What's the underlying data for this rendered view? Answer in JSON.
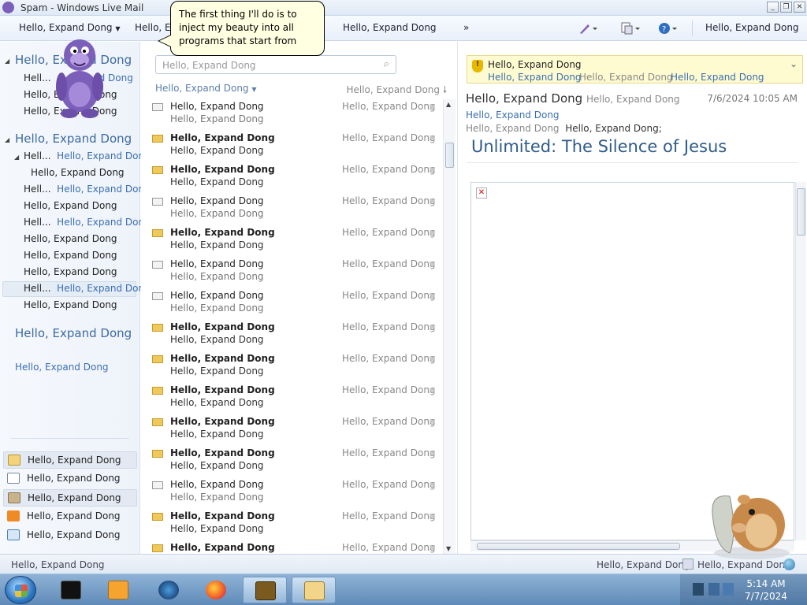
{
  "window": {
    "title": "Spam - Windows Live Mail"
  },
  "toolbar": {
    "items": [
      {
        "label": "Hello, Expand Dong",
        "dropdown": true
      },
      {
        "label": "Hello, Ex"
      },
      {
        "label": "Hello, Expand Dong"
      },
      {
        "label": "»"
      }
    ],
    "right_label": "Hello, Expand Dong",
    "icons": [
      "paint-brush-icon",
      "layout-icon",
      "help-icon"
    ]
  },
  "nav": {
    "groups": [
      {
        "header": "Hello, Expand Dong",
        "rows": [
          "Hell...",
          "Hello, Expand Dong",
          "Hello, Expand Dong"
        ]
      },
      {
        "header": "Hello, Expand Dong",
        "rows": [
          {
            "label": "Hell...",
            "count": "Hello, Expand Dong",
            "expanded": true
          },
          {
            "label": "Hello, Expand Dong"
          },
          {
            "label": "Hell...",
            "count": "Hello, Expand Dong"
          },
          {
            "label": "Hello, Expand Dong"
          },
          {
            "label": "Hell...",
            "count": "Hello, Expand Dong"
          },
          {
            "label": "Hello, Expand Dong"
          },
          {
            "label": "Hello, Expand Dong"
          },
          {
            "label": "Hello, Expand Dong"
          },
          {
            "label": "Hell...",
            "count": "Hello, Expand Dong",
            "selected": true
          },
          {
            "label": "Hello, Expand Dong"
          }
        ]
      },
      {
        "header": "Hello, Expand Dong",
        "rows": []
      }
    ],
    "link": "Hello, Expand Dong",
    "bottom": [
      {
        "label": "Hello, Expand Dong",
        "icon": "mail-icon"
      },
      {
        "label": "Hello, Expand Dong",
        "icon": "calendar-icon"
      },
      {
        "label": "Hello, Expand Dong",
        "icon": "contacts-icon"
      },
      {
        "label": "Hello, Expand Dong",
        "icon": "feeds-icon"
      },
      {
        "label": "Hello, Expand Dong",
        "icon": "newsgroups-icon"
      }
    ]
  },
  "list": {
    "search_placeholder": "Hello, Expand Dong",
    "sort_by": "Hello, Expand Dong",
    "sort_order": "Hello, Expand Dong",
    "messages": [
      {
        "from": "Hello, Expand Dong",
        "subject": "Hello, Expand Dong",
        "date": "Hello, Expand Dong",
        "unread": false
      },
      {
        "from": "Hello, Expand Dong",
        "subject": "Hello, Expand Dong",
        "date": "Hello, Expand Dong",
        "unread": true
      },
      {
        "from": "Hello, Expand Dong",
        "subject": "Hello, Expand Dong",
        "date": "Hello, Expand Dong",
        "unread": true
      },
      {
        "from": "Hello, Expand Dong",
        "subject": "Hello, Expand Dong",
        "date": "Hello, Expand Dong",
        "unread": false
      },
      {
        "from": "Hello, Expand Dong",
        "subject": "Hello, Expand Dong",
        "date": "Hello, Expand Dong",
        "unread": true
      },
      {
        "from": "Hello, Expand Dong",
        "subject": "Hello, Expand Dong",
        "date": "Hello, Expand Dong",
        "unread": false
      },
      {
        "from": "Hello, Expand Dong",
        "subject": "Hello, Expand Dong",
        "date": "Hello, Expand Dong",
        "unread": false
      },
      {
        "from": "Hello, Expand Dong",
        "subject": "Hello, Expand Dong",
        "date": "Hello, Expand Dong",
        "unread": true
      },
      {
        "from": "Hello, Expand Dong",
        "subject": "Hello, Expand Dong",
        "date": "Hello, Expand Dong",
        "unread": true
      },
      {
        "from": "Hello, Expand Dong",
        "subject": "Hello, Expand Dong",
        "date": "Hello, Expand Dong",
        "unread": true
      },
      {
        "from": "Hello, Expand Dong",
        "subject": "Hello, Expand Dong",
        "date": "Hello, Expand Dong",
        "unread": true
      },
      {
        "from": "Hello, Expand Dong",
        "subject": "Hello, Expand Dong",
        "date": "Hello, Expand Dong",
        "unread": true
      },
      {
        "from": "Hello, Expand Dong",
        "subject": "Hello, Expand Dong",
        "date": "Hello, Expand Dong",
        "unread": false
      },
      {
        "from": "Hello, Expand Dong",
        "subject": "Hello, Expand Dong",
        "date": "Hello, Expand Dong",
        "unread": true
      },
      {
        "from": "Hello, Expand Dong",
        "subject": "",
        "date": "Hello, Expand Dong",
        "unread": true
      }
    ]
  },
  "reading": {
    "warning_title": "Hello, Expand Dong",
    "warning_links": [
      "Hello, Expand Dong",
      "Hello, Expand Dong",
      "Hello, Expand Dong"
    ],
    "from_name": "Hello, Expand Dong",
    "from_email": "Hello, Expand Dong",
    "date": "7/6/2024 10:05 AM",
    "to": "Hello, Expand Dong",
    "cc_label": "Hello, Expand Dong",
    "cc_value": "Hello, Expand Dong;",
    "subject": "Unlimited: The Silence of Jesus"
  },
  "status": {
    "left": "Hello, Expand Dong",
    "right1": "Hello, Expand Dong",
    "right2": "Hello, Expand Dong"
  },
  "bubble": {
    "text": "The first thing I'll do is to inject my beauty into all programs that start from"
  },
  "taskbar": {
    "time": "5:14 AM",
    "date": "7/7/2024"
  },
  "colors": {
    "accent": "#3a6fb0",
    "subject": "#2f5c8a",
    "warn_bg": "#fffbd1",
    "bonzi": "#7b5fb8"
  }
}
